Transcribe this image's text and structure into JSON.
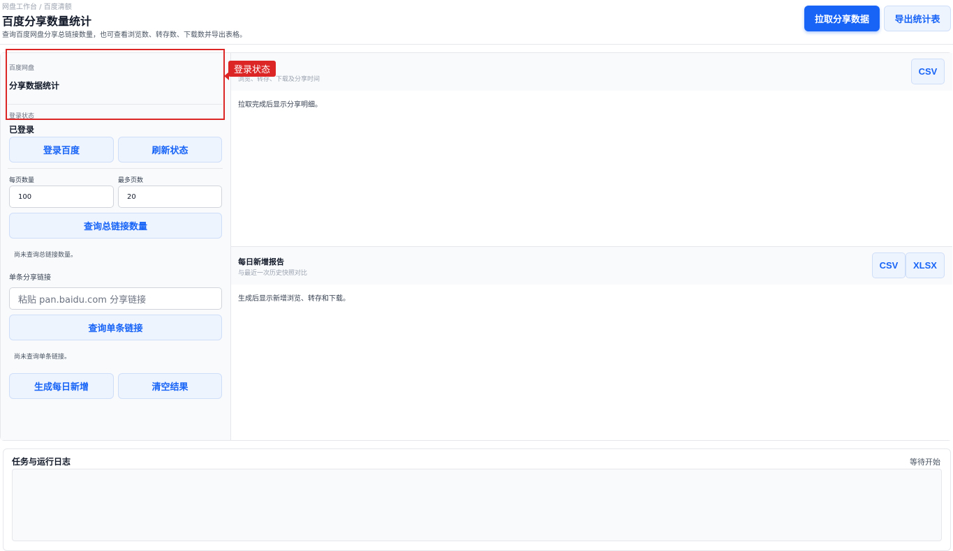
{
  "header": {
    "breadcrumb": "网盘工作台 / 百度清额",
    "title": "百度分享数量统计",
    "subtitle": "查询百度网盘分享总链接数量，也可查看浏览数、转存数、下载数并导出表格。",
    "fetch_button": "拉取分享数据",
    "export_button": "导出统计表"
  },
  "sidebar": {
    "brand_small": "百度网盘",
    "brand_title": "分享数据统计",
    "login_label": "登录状态",
    "login_value": "已登录",
    "login_button": "登录百度",
    "refresh_button": "刷新状态",
    "per_page_label": "每页数量",
    "per_page_value": "100",
    "max_pages_label": "最多页数",
    "max_pages_value": "20",
    "query_total_button": "查询总链接数量",
    "total_note": "尚未查询总链接数量。",
    "single_label": "单条分享链接",
    "single_placeholder": "粘贴 pan.baidu.com 分享链接",
    "query_single_button": "查询单条链接",
    "single_note": "尚未查询单条链接。",
    "daily_button": "生成每日新增",
    "clear_button": "清空结果"
  },
  "annotation": {
    "tag": "登录状态"
  },
  "details_panel": {
    "subtitle": "浏览、转存、下载及分享时间",
    "csv_button": "CSV",
    "body": "拉取完成后显示分享明细。"
  },
  "daily_panel": {
    "title": "每日新增报告",
    "subtitle": "与最近一次历史快照对比",
    "csv_button": "CSV",
    "xlsx_button": "XLSX",
    "body": "生成后显示新增浏览、转存和下载。"
  },
  "log": {
    "title": "任务与运行日志",
    "status": "等待开始"
  }
}
